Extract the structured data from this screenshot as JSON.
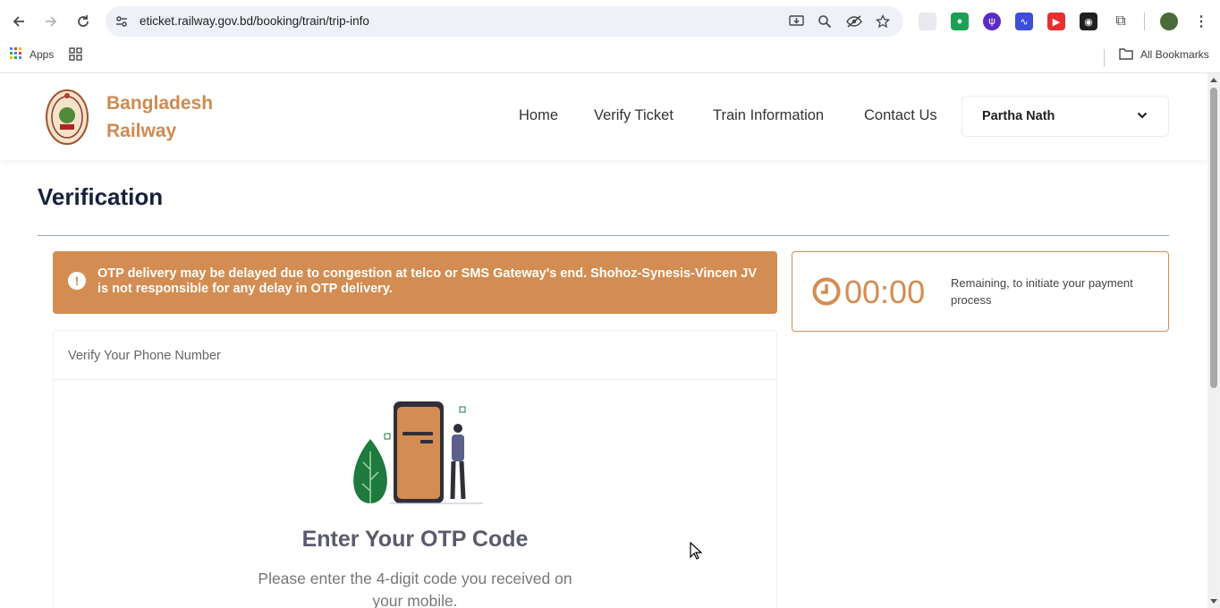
{
  "browser": {
    "url": "eticket.railway.gov.bd/booking/train/trip-info",
    "bookmarks_apps_label": "Apps",
    "all_bookmarks_label": "All Bookmarks"
  },
  "header": {
    "brand_line1": "Bangladesh",
    "brand_line2": "Railway",
    "nav": {
      "home": "Home",
      "verify_ticket": "Verify Ticket",
      "train_information": "Train Information",
      "contact_us": "Contact Us"
    },
    "user_name": "Partha Nath"
  },
  "page": {
    "title": "Verification",
    "alert_icon": "!",
    "alert_text": "OTP delivery may be delayed due to congestion at telco or SMS Gateway's end. Shohoz-Synesis-Vincen JV is not responsible for any delay in OTP delivery.",
    "timer_value": "00:00",
    "timer_label": "Remaining, to initiate your payment process",
    "card_header": "Verify Your Phone Number",
    "otp_title": "Enter Your OTP Code",
    "otp_subtitle": "Please enter the 4-digit code you received on your mobile."
  },
  "colors": {
    "accent": "#d38d52",
    "title": "#16213a"
  }
}
